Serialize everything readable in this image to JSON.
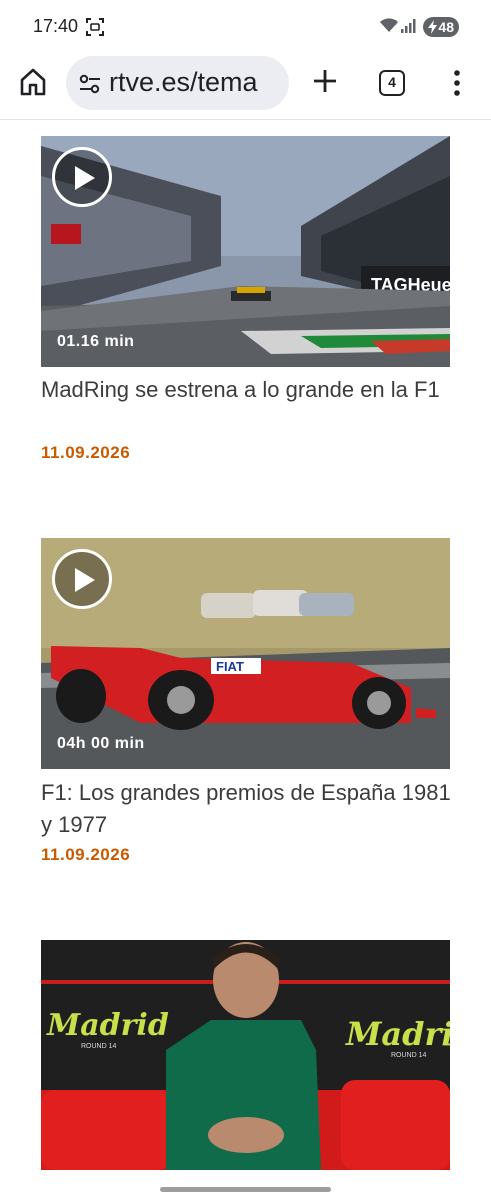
{
  "status_bar": {
    "time": "17:40",
    "battery": "48"
  },
  "browser": {
    "url": "rtve.es/tema",
    "tab_count": "4"
  },
  "articles": [
    {
      "duration": "01.16 min",
      "title": "MadRing se estrena a lo grande en la F1",
      "date": "11.09.2026"
    },
    {
      "duration": "04h 00 min",
      "title": "F1: Los grandes premios de España 1981 y 1977",
      "date": "11.09.2026"
    },
    {
      "duration": "",
      "title": "",
      "date": ""
    }
  ],
  "thumb_text": {
    "madrid_1": "Madrid",
    "madrid_2": "Madrid",
    "round": "ROUND 14",
    "round_2": "ROUND 14",
    "fiat": "FIAT",
    "tagheuer": "TAGHeuer"
  }
}
